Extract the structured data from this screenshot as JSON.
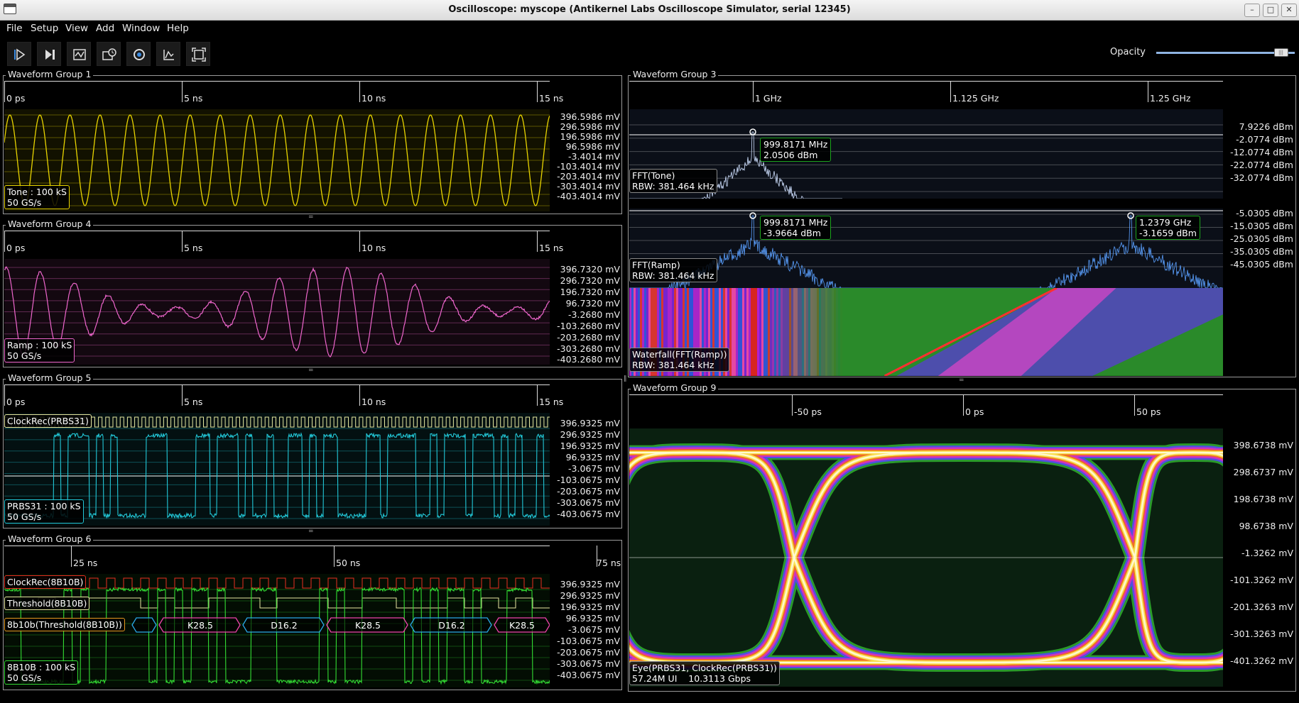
{
  "window": {
    "title": "Oscilloscope: myscope (Antikernel Labs Oscilloscope Simulator, serial 12345)"
  },
  "menu": [
    "File",
    "Setup",
    "View",
    "Add",
    "Window",
    "Help"
  ],
  "toolbar": {
    "opacity_label": "Opacity",
    "opacity_value": 0.9,
    "buttons": [
      "start-icon",
      "single-trigger-icon",
      "stop-icon",
      "history-icon",
      "refresh-icon",
      "autofit-icon",
      "fullscreen-icon"
    ]
  },
  "groups": {
    "g1": {
      "title": "Waveform Group 1",
      "time_labels": [
        "0 ps",
        "5 ns",
        "10 ns",
        "15 ns"
      ],
      "y_labels": [
        "396.5986 mV",
        "296.5986 mV",
        "196.5986 mV",
        "96.5986 mV",
        "-3.4014 mV",
        "-103.4014 mV",
        "-203.4014 mV",
        "-303.4014 mV",
        "-403.4014 mV"
      ],
      "channel": {
        "line1": "Tone : 100 kS",
        "line2": "50 GS/s",
        "color": "#e8d400"
      }
    },
    "g4": {
      "title": "Waveform Group 4",
      "time_labels": [
        "0 ps",
        "5 ns",
        "10 ns",
        "15 ns"
      ],
      "y_labels": [
        "396.7320 mV",
        "296.7320 mV",
        "196.7320 mV",
        "96.7320 mV",
        "-3.2680 mV",
        "-103.2680 mV",
        "-203.2680 mV",
        "-303.2680 mV",
        "-403.2680 mV"
      ],
      "channel": {
        "line1": "Ramp : 100 kS",
        "line2": "50 GS/s",
        "color": "#ee66cc"
      }
    },
    "g5": {
      "title": "Waveform Group 5",
      "time_labels": [
        "0 ps",
        "5 ns",
        "10 ns",
        "15 ns"
      ],
      "y_labels": [
        "396.9325 mV",
        "296.9325 mV",
        "196.9325 mV",
        "96.9325 mV",
        "-3.0675 mV",
        "-103.0675 mV",
        "-203.0675 mV",
        "-303.0675 mV",
        "-403.0675 mV"
      ],
      "clock_label": "ClockRec(PRBS31)",
      "channel": {
        "line1": "PRBS31 : 100 kS",
        "line2": "50 GS/s",
        "color": "#22c8d8"
      }
    },
    "g6": {
      "title": "Waveform Group 6",
      "time_labels": [
        "25 ns",
        "50 ns",
        "75 ns"
      ],
      "y_labels": [
        "396.9325 mV",
        "296.9325 mV",
        "196.9325 mV",
        "96.9325 mV",
        "-3.0675 mV",
        "-103.0675 mV",
        "-203.0675 mV",
        "-303.0675 mV",
        "-403.0675 mV"
      ],
      "clock_label": "ClockRec(8B10B)",
      "threshold_label": "Threshold(8B10B)",
      "decode_label": "8b10b(Threshold(8B10B))",
      "symbols": [
        "K28.5",
        "D16.2",
        "K28.5",
        "D16.2",
        "K28.5"
      ],
      "channel": {
        "line1": "8B10B : 100 kS",
        "line2": "50 GS/s",
        "color": "#33dd33"
      }
    },
    "g3": {
      "title": "Waveform Group 3",
      "freq_labels": [
        "1 GHz",
        "1.125 GHz",
        "1.25 GHz"
      ],
      "fft_tone": {
        "y_labels": [
          "7.9226 dBm",
          "-2.0774 dBm",
          "-12.0774 dBm",
          "-22.0774 dBm",
          "-32.0774 dBm"
        ],
        "label_line1": "FFT(Tone)",
        "label_line2": "RBW: 381.464 kHz",
        "cursor_freq": "999.8171 MHz",
        "cursor_level": "2.0506 dBm"
      },
      "fft_ramp": {
        "y_labels": [
          "-5.0305 dBm",
          "-15.0305 dBm",
          "-25.0305 dBm",
          "-35.0305 dBm",
          "-45.0305 dBm"
        ],
        "label_line1": "FFT(Ramp)",
        "label_line2": "RBW: 381.464 kHz",
        "cursor1_freq": "999.8171 MHz",
        "cursor1_level": "-3.9664 dBm",
        "cursor2_freq": "1.2379 GHz",
        "cursor2_level": "-3.1659 dBm"
      },
      "waterfall": {
        "label_line1": "Waterfall(FFT(Ramp))",
        "label_line2": "RBW: 381.464 kHz"
      }
    },
    "g9": {
      "title": "Waveform Group 9",
      "time_labels": [
        "-50 ps",
        "0 ps",
        "50 ps"
      ],
      "y_labels": [
        "398.6738 mV",
        "298.6737 mV",
        "198.6738 mV",
        "98.6738 mV",
        "-1.3262 mV",
        "-101.3262 mV",
        "-201.3263 mV",
        "-301.3263 mV",
        "-401.3262 mV"
      ],
      "eye_label": "Eye(PRBS31, ClockRec(PRBS31))",
      "eye_ui": "57.24M UI",
      "eye_rate": "10.3113 Gbps"
    }
  }
}
